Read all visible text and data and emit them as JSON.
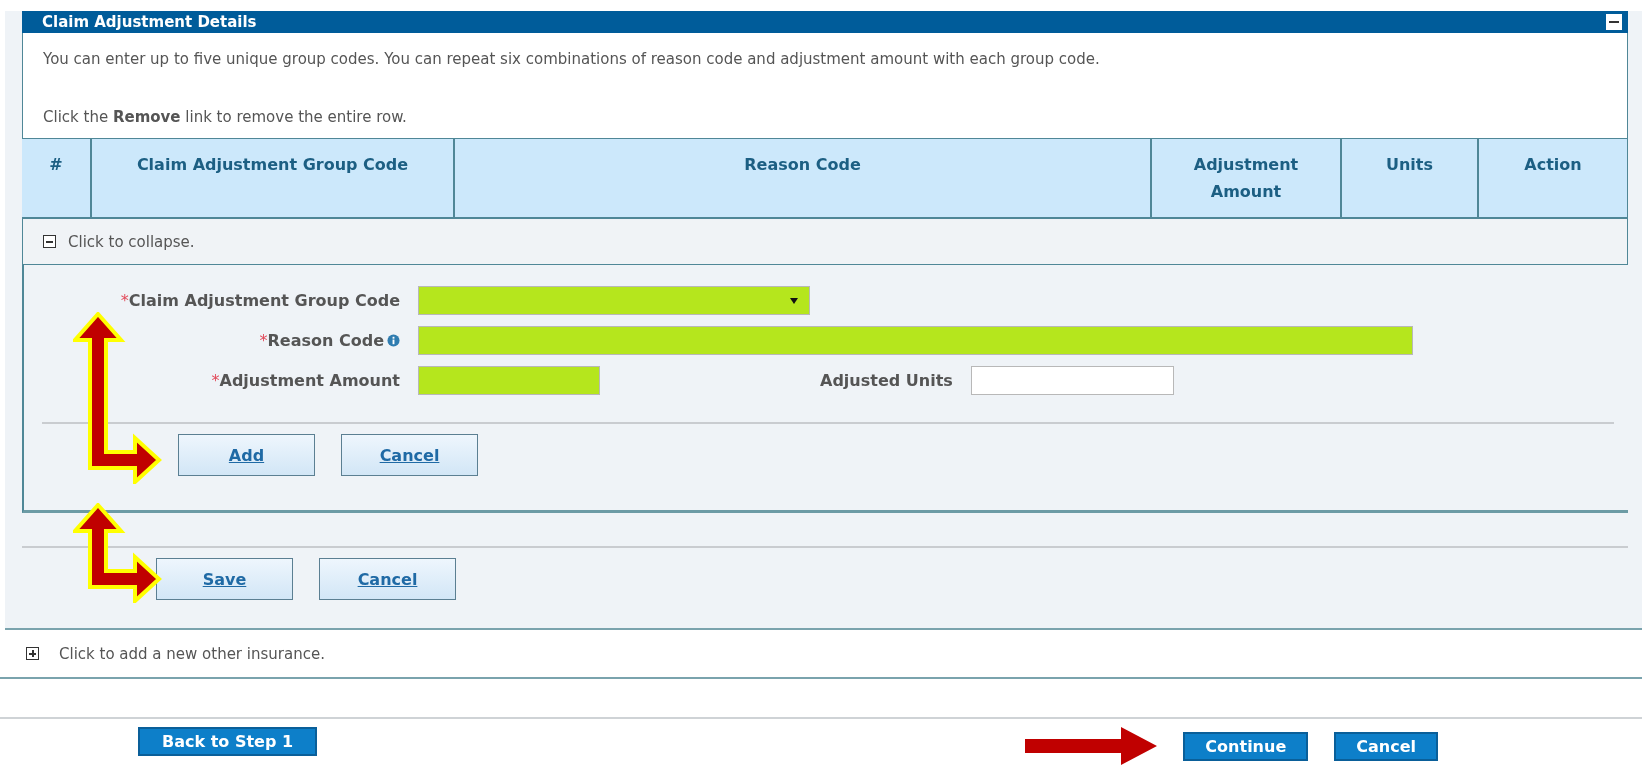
{
  "section": {
    "title": "Claim Adjustment Details",
    "expanded": true,
    "instructions": [
      "You can enter up to five unique group codes. You can repeat six combinations of reason code and adjustment amount with each group code.",
      "Click the **Remove** link to remove the entire row."
    ],
    "table": {
      "columns": [
        "#",
        "Claim Adjustment Group Code",
        "Reason Code",
        "Adjustment Amount",
        "Units",
        "Action"
      ]
    },
    "row_toggle": {
      "text": "Click to collapse.",
      "expanded": true
    },
    "form_rows": [
      {
        "fields": [
          {
            "kind": "select",
            "marker": "*",
            "label": "Claim Adjustment Group Code",
            "required": true,
            "help": false
          }
        ]
      },
      {
        "fields": [
          {
            "kind": "text",
            "marker": "*",
            "label": "Reason Code",
            "required": true,
            "help": true
          }
        ]
      },
      {
        "fields": [
          {
            "kind": "text",
            "marker": "*",
            "label": "Adjustment Amount",
            "required": true,
            "help": false
          },
          {
            "kind": "text",
            "label": "Adjusted Units",
            "required": false,
            "help": false
          }
        ]
      }
    ],
    "row_buttons": [
      "Add",
      "Cancel"
    ],
    "section_buttons": [
      "Save",
      "Cancel"
    ]
  },
  "other_insurance": {
    "text": "Click to add a new other insurance.",
    "expanded": false
  },
  "footer": {
    "left_buttons": [
      "Back to Step 1"
    ],
    "right_buttons": [
      "Continue",
      "Cancel"
    ]
  }
}
